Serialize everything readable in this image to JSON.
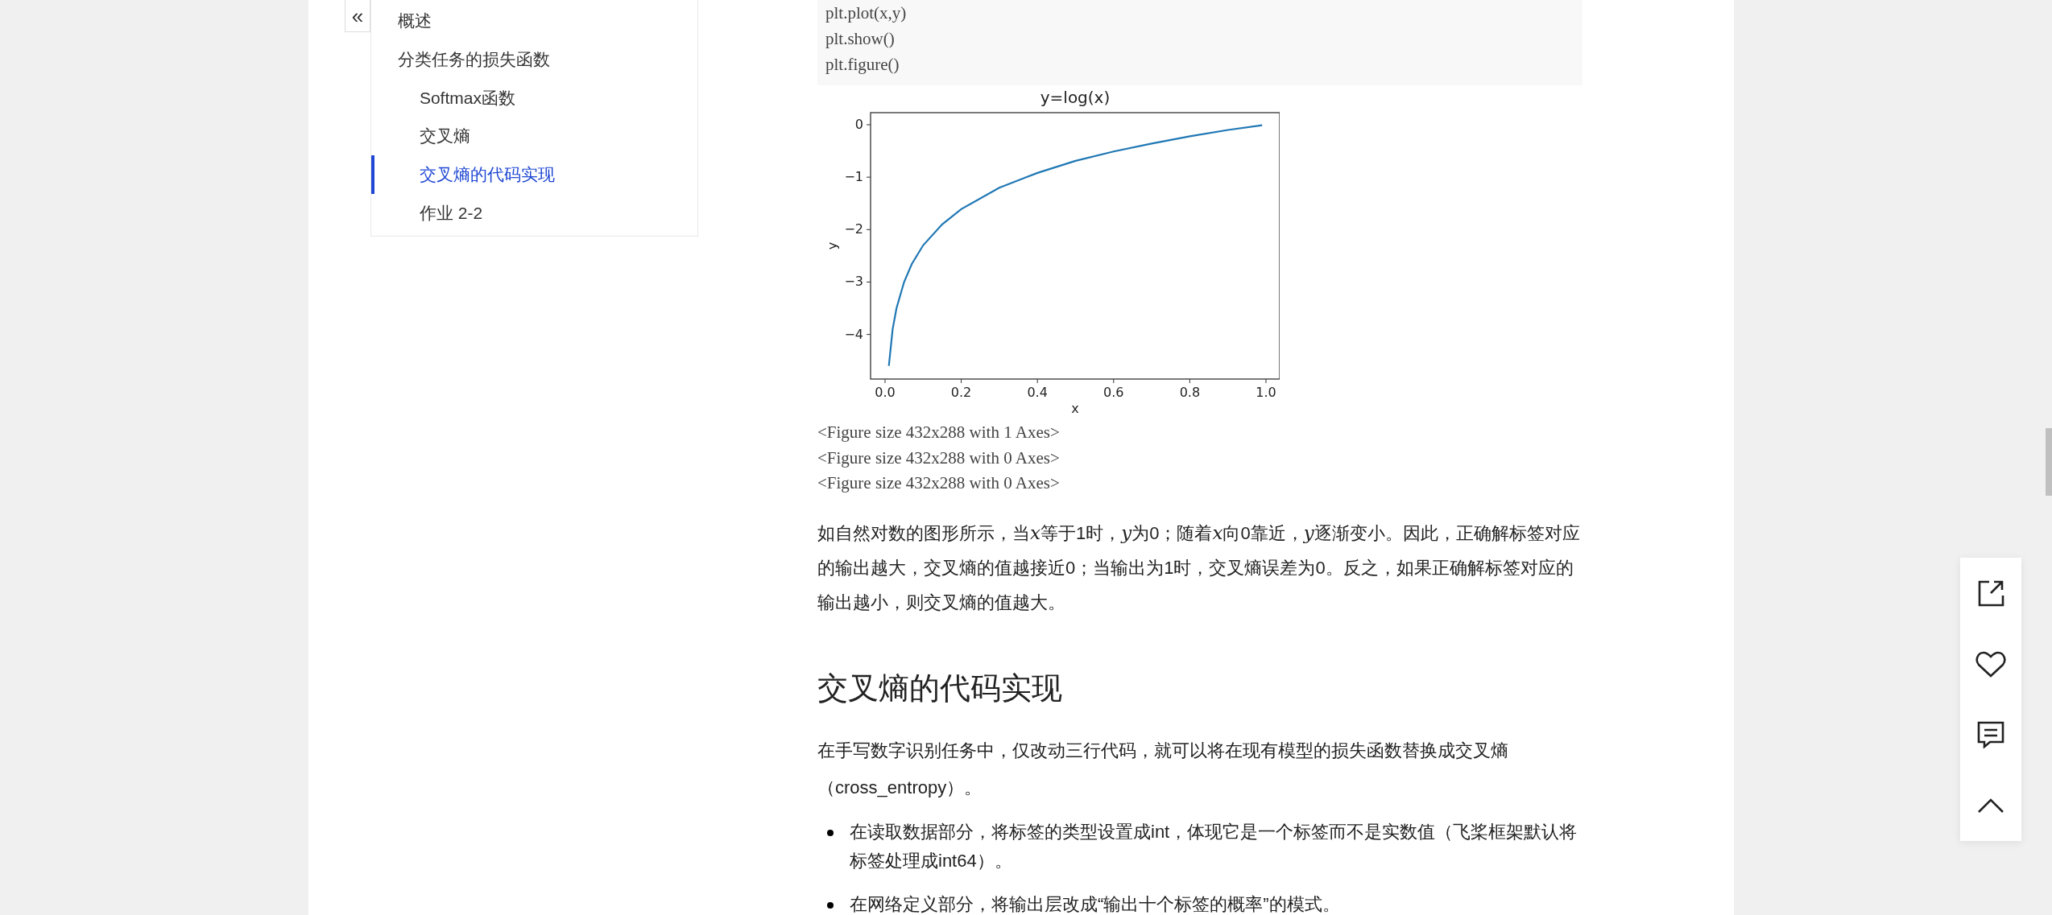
{
  "sidebar": {
    "collapse_button": "«",
    "toc": [
      {
        "label": "概述",
        "selected": false
      },
      {
        "label": "分类任务的损失函数",
        "selected": false,
        "children": [
          {
            "label": "Softmax函数",
            "selected": false
          },
          {
            "label": "交叉熵",
            "selected": false
          },
          {
            "label": "交叉熵的代码实现",
            "selected": true
          },
          {
            "label": "作业 2-2",
            "selected": false
          }
        ]
      }
    ]
  },
  "article": {
    "code_lines": [
      "plt.plot(x,y)",
      "plt.show()",
      "plt.figure()"
    ],
    "figure": {
      "chart_data": {
        "type": "line",
        "title": "y=log(x)",
        "xlabel": "x",
        "ylabel": "y",
        "x": [
          0.01,
          0.02,
          0.03,
          0.05,
          0.07,
          0.1,
          0.15,
          0.2,
          0.3,
          0.4,
          0.5,
          0.6,
          0.7,
          0.8,
          0.9,
          0.99
        ],
        "series": [
          {
            "color": "#1f77b4",
            "values": [
              -4.6,
              -3.9,
              -3.5,
              -3.0,
              -2.66,
              -2.3,
              -1.9,
              -1.61,
              -1.2,
              -0.92,
              -0.69,
              -0.51,
              -0.36,
              -0.22,
              -0.1,
              -0.01
            ]
          }
        ],
        "xlim": [
          -0.038,
          1.036
        ],
        "ylim": [
          -4.85,
          0.23
        ],
        "xticks": [
          {
            "value": 0,
            "label": "0.0"
          },
          {
            "value": 0.2,
            "label": "0.2"
          },
          {
            "value": 0.4,
            "label": "0.4"
          },
          {
            "value": 0.6,
            "label": "0.6"
          },
          {
            "value": 0.8,
            "label": "0.8"
          },
          {
            "value": 1,
            "label": "1.0"
          }
        ],
        "yticks": [
          {
            "value": 0,
            "label": "0"
          },
          {
            "value": -1,
            "label": "−1"
          },
          {
            "value": -2,
            "label": "−2"
          },
          {
            "value": -3,
            "label": "−3"
          },
          {
            "value": -4,
            "label": "−4"
          }
        ]
      }
    },
    "output_lines": [
      "<Figure size 432x288 with 1 Axes>",
      "<Figure size 432x288 with 0 Axes>",
      "<Figure size 432x288 with 0 Axes>"
    ],
    "paragraph": [
      {
        "kind": "text",
        "text": "如自然对数的图形所示，当"
      },
      {
        "kind": "math",
        "text": "x"
      },
      {
        "kind": "text",
        "text": "等于1时，"
      },
      {
        "kind": "math",
        "text": "y"
      },
      {
        "kind": "text",
        "text": "为0；随着"
      },
      {
        "kind": "math",
        "text": "x"
      },
      {
        "kind": "text",
        "text": "向0靠近，"
      },
      {
        "kind": "math",
        "text": "y"
      },
      {
        "kind": "text",
        "text": "逐渐变小。因此，正确解标签对应的输出越大，交叉熵的值越接近0；当输出为1时，交叉熵误差为0。反之，如果正确解标签对应的输出越小，则交叉熵的值越大。"
      }
    ],
    "heading": "交叉熵的代码实现",
    "intro": "在手写数字识别任务中，仅改动三行代码，就可以将在现有模型的损失函数替换成交叉熵（cross_entropy）。",
    "bullets": [
      "在读取数据部分，将标签的类型设置成int，体现它是一个标签而不是实数值（飞桨框架默认将标签处理成int64）。",
      "在网络定义部分，将输出层改成“输出十个标签的概率”的模式。"
    ]
  },
  "toolbar": [
    {
      "kind": "share"
    },
    {
      "kind": "like"
    },
    {
      "kind": "comment"
    },
    {
      "kind": "top"
    }
  ]
}
